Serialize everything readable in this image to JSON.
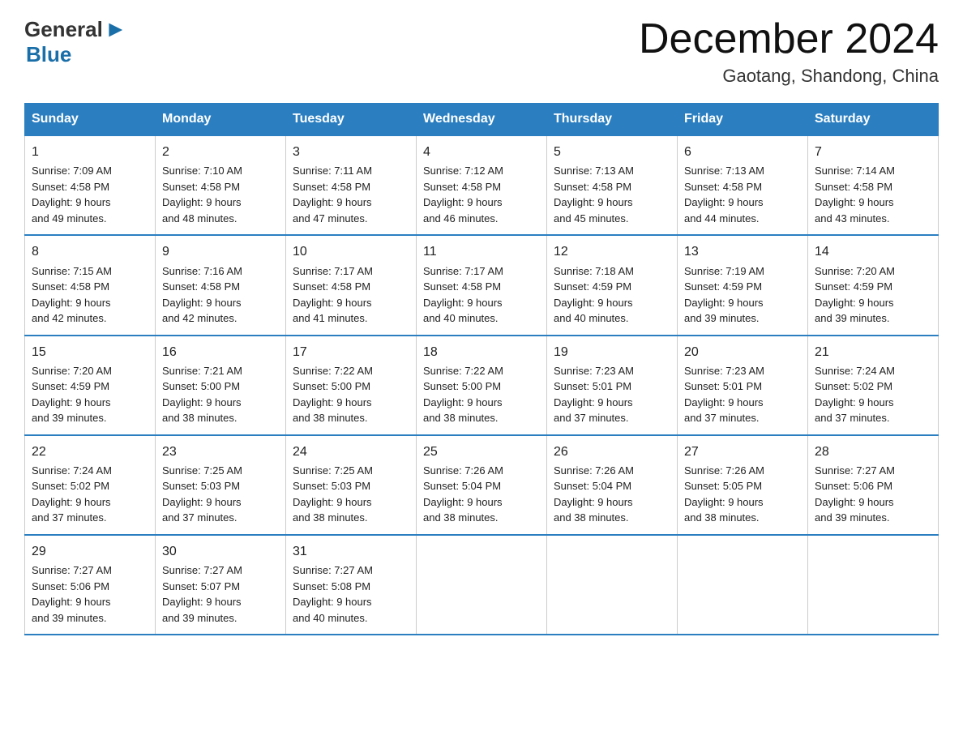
{
  "logo": {
    "general": "General",
    "blue": "Blue",
    "arrow": "▶"
  },
  "title": {
    "month": "December 2024",
    "location": "Gaotang, Shandong, China"
  },
  "headers": [
    "Sunday",
    "Monday",
    "Tuesday",
    "Wednesday",
    "Thursday",
    "Friday",
    "Saturday"
  ],
  "weeks": [
    [
      {
        "day": "1",
        "info": "Sunrise: 7:09 AM\nSunset: 4:58 PM\nDaylight: 9 hours\nand 49 minutes."
      },
      {
        "day": "2",
        "info": "Sunrise: 7:10 AM\nSunset: 4:58 PM\nDaylight: 9 hours\nand 48 minutes."
      },
      {
        "day": "3",
        "info": "Sunrise: 7:11 AM\nSunset: 4:58 PM\nDaylight: 9 hours\nand 47 minutes."
      },
      {
        "day": "4",
        "info": "Sunrise: 7:12 AM\nSunset: 4:58 PM\nDaylight: 9 hours\nand 46 minutes."
      },
      {
        "day": "5",
        "info": "Sunrise: 7:13 AM\nSunset: 4:58 PM\nDaylight: 9 hours\nand 45 minutes."
      },
      {
        "day": "6",
        "info": "Sunrise: 7:13 AM\nSunset: 4:58 PM\nDaylight: 9 hours\nand 44 minutes."
      },
      {
        "day": "7",
        "info": "Sunrise: 7:14 AM\nSunset: 4:58 PM\nDaylight: 9 hours\nand 43 minutes."
      }
    ],
    [
      {
        "day": "8",
        "info": "Sunrise: 7:15 AM\nSunset: 4:58 PM\nDaylight: 9 hours\nand 42 minutes."
      },
      {
        "day": "9",
        "info": "Sunrise: 7:16 AM\nSunset: 4:58 PM\nDaylight: 9 hours\nand 42 minutes."
      },
      {
        "day": "10",
        "info": "Sunrise: 7:17 AM\nSunset: 4:58 PM\nDaylight: 9 hours\nand 41 minutes."
      },
      {
        "day": "11",
        "info": "Sunrise: 7:17 AM\nSunset: 4:58 PM\nDaylight: 9 hours\nand 40 minutes."
      },
      {
        "day": "12",
        "info": "Sunrise: 7:18 AM\nSunset: 4:59 PM\nDaylight: 9 hours\nand 40 minutes."
      },
      {
        "day": "13",
        "info": "Sunrise: 7:19 AM\nSunset: 4:59 PM\nDaylight: 9 hours\nand 39 minutes."
      },
      {
        "day": "14",
        "info": "Sunrise: 7:20 AM\nSunset: 4:59 PM\nDaylight: 9 hours\nand 39 minutes."
      }
    ],
    [
      {
        "day": "15",
        "info": "Sunrise: 7:20 AM\nSunset: 4:59 PM\nDaylight: 9 hours\nand 39 minutes."
      },
      {
        "day": "16",
        "info": "Sunrise: 7:21 AM\nSunset: 5:00 PM\nDaylight: 9 hours\nand 38 minutes."
      },
      {
        "day": "17",
        "info": "Sunrise: 7:22 AM\nSunset: 5:00 PM\nDaylight: 9 hours\nand 38 minutes."
      },
      {
        "day": "18",
        "info": "Sunrise: 7:22 AM\nSunset: 5:00 PM\nDaylight: 9 hours\nand 38 minutes."
      },
      {
        "day": "19",
        "info": "Sunrise: 7:23 AM\nSunset: 5:01 PM\nDaylight: 9 hours\nand 37 minutes."
      },
      {
        "day": "20",
        "info": "Sunrise: 7:23 AM\nSunset: 5:01 PM\nDaylight: 9 hours\nand 37 minutes."
      },
      {
        "day": "21",
        "info": "Sunrise: 7:24 AM\nSunset: 5:02 PM\nDaylight: 9 hours\nand 37 minutes."
      }
    ],
    [
      {
        "day": "22",
        "info": "Sunrise: 7:24 AM\nSunset: 5:02 PM\nDaylight: 9 hours\nand 37 minutes."
      },
      {
        "day": "23",
        "info": "Sunrise: 7:25 AM\nSunset: 5:03 PM\nDaylight: 9 hours\nand 37 minutes."
      },
      {
        "day": "24",
        "info": "Sunrise: 7:25 AM\nSunset: 5:03 PM\nDaylight: 9 hours\nand 38 minutes."
      },
      {
        "day": "25",
        "info": "Sunrise: 7:26 AM\nSunset: 5:04 PM\nDaylight: 9 hours\nand 38 minutes."
      },
      {
        "day": "26",
        "info": "Sunrise: 7:26 AM\nSunset: 5:04 PM\nDaylight: 9 hours\nand 38 minutes."
      },
      {
        "day": "27",
        "info": "Sunrise: 7:26 AM\nSunset: 5:05 PM\nDaylight: 9 hours\nand 38 minutes."
      },
      {
        "day": "28",
        "info": "Sunrise: 7:27 AM\nSunset: 5:06 PM\nDaylight: 9 hours\nand 39 minutes."
      }
    ],
    [
      {
        "day": "29",
        "info": "Sunrise: 7:27 AM\nSunset: 5:06 PM\nDaylight: 9 hours\nand 39 minutes."
      },
      {
        "day": "30",
        "info": "Sunrise: 7:27 AM\nSunset: 5:07 PM\nDaylight: 9 hours\nand 39 minutes."
      },
      {
        "day": "31",
        "info": "Sunrise: 7:27 AM\nSunset: 5:08 PM\nDaylight: 9 hours\nand 40 minutes."
      },
      {
        "day": "",
        "info": ""
      },
      {
        "day": "",
        "info": ""
      },
      {
        "day": "",
        "info": ""
      },
      {
        "day": "",
        "info": ""
      }
    ]
  ]
}
